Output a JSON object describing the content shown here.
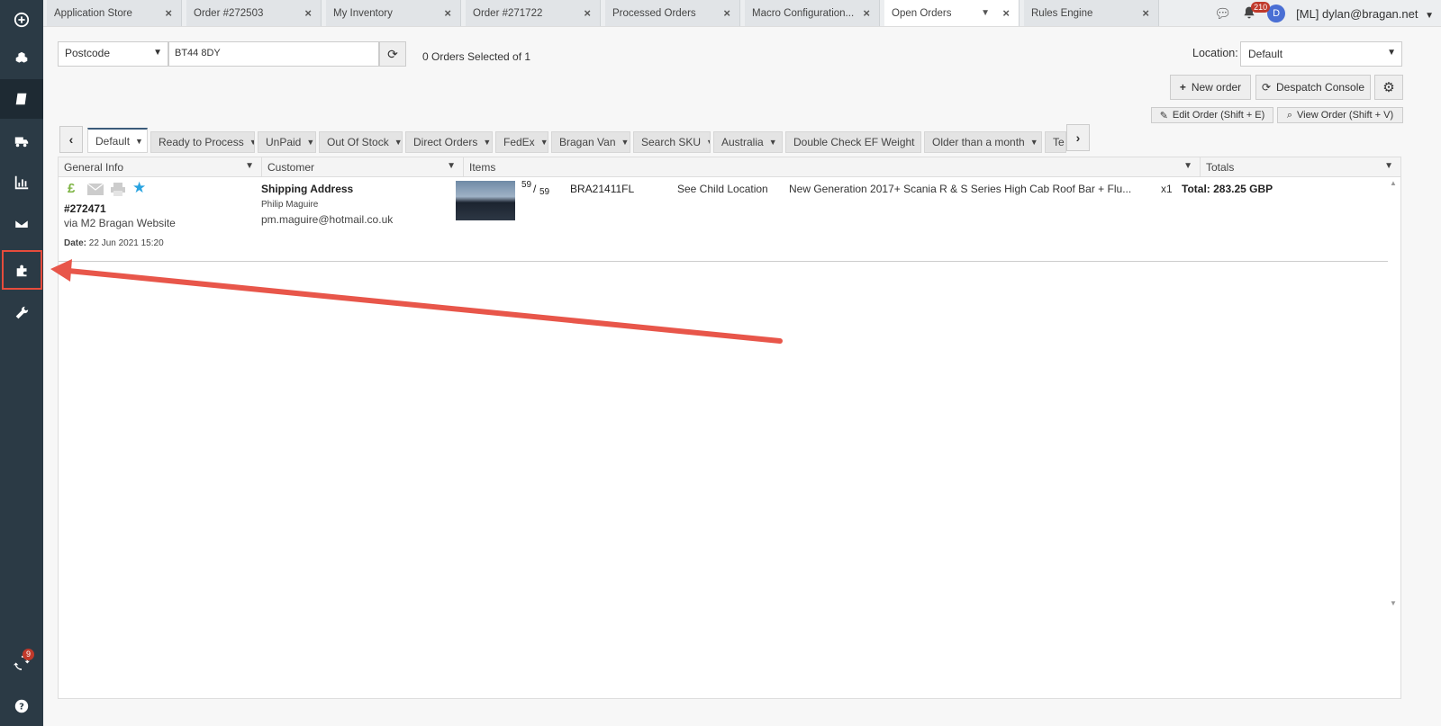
{
  "sidebar": {
    "sync_badge": "9"
  },
  "top_tabs": [
    {
      "label": "Application Store"
    },
    {
      "label": "Order #272503"
    },
    {
      "label": "My Inventory"
    },
    {
      "label": "Order #271722"
    },
    {
      "label": "Processed Orders"
    },
    {
      "label": "Macro Configuration..."
    },
    {
      "label": "Open Orders"
    },
    {
      "label": "Rules Engine"
    }
  ],
  "header": {
    "notification_count": "210",
    "avatar_letter": "D",
    "user": "[ML] dylan@bragan.net"
  },
  "search": {
    "type": "Postcode",
    "value": "BT44 8DY",
    "selected_text": "0 Orders Selected of 1"
  },
  "location": {
    "label": "Location:",
    "value": "Default"
  },
  "actions": {
    "new_order": "New order",
    "despatch_console": "Despatch Console",
    "edit_order": "Edit Order (Shift + E)",
    "view_order": "View Order (Shift + V)"
  },
  "view_tabs": [
    {
      "label": "Default"
    },
    {
      "label": "Ready to Process"
    },
    {
      "label": "UnPaid"
    },
    {
      "label": "Out Of Stock"
    },
    {
      "label": "Direct Orders"
    },
    {
      "label": "FedEx"
    },
    {
      "label": "Bragan Van"
    },
    {
      "label": "Search SKU"
    },
    {
      "label": "Australia"
    },
    {
      "label": "Double Check EF Weight"
    },
    {
      "label": "Older than a month"
    },
    {
      "label": "Te"
    }
  ],
  "columns": {
    "general_info": "General Info",
    "customer": "Customer",
    "items": "Items",
    "totals": "Totals"
  },
  "order": {
    "number": "#272471",
    "source": "via M2 Bragan Website",
    "date_label": "Date:",
    "date": "22 Jun 2021 15:20",
    "address_title": "Shipping Address",
    "customer_name": "Philip Maguire",
    "email": "pm.maguire@hotmail.co.uk",
    "stock_top": "59",
    "stock_sep": "/",
    "stock_bottom": "59",
    "sku": "BRA21411FL",
    "location": "See Child Location",
    "title": "New Generation 2017+ Scania R & S Series High Cab Roof Bar + Flu...",
    "qty": "x1",
    "total": "Total: 283.25 GBP"
  },
  "colors": {
    "sidebar": "#2b3a45",
    "highlight": "#e74c3c",
    "badge": "#c0392b",
    "paid_icon": "#7cb342",
    "star_icon": "#29a3e0"
  }
}
